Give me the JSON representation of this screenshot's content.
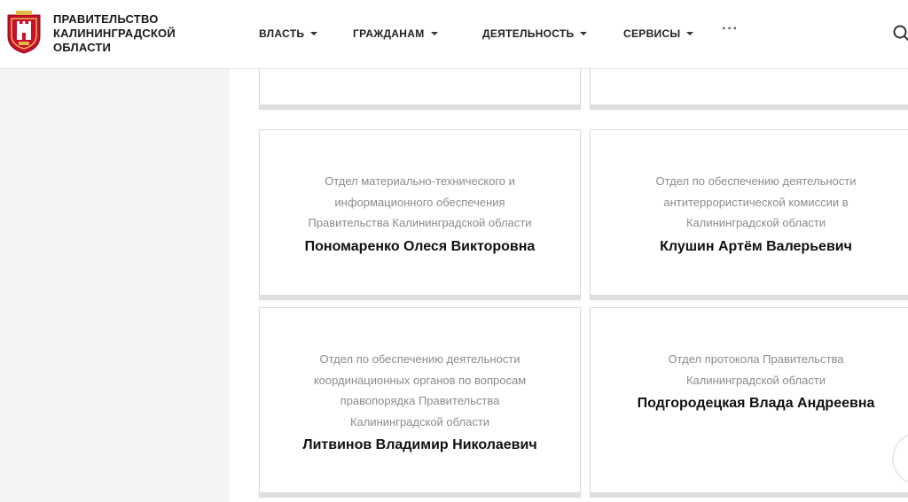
{
  "header": {
    "org_name": [
      "ПРАВИТЕЛЬСТВО",
      "КАЛИНИНГРАДСКОЙ",
      "ОБЛАСТИ"
    ],
    "logo_icon": "coat-of-arms-icon",
    "nav": [
      {
        "label": "ВЛАСТЬ"
      },
      {
        "label": "ГРАЖДАНАМ"
      },
      {
        "label": "ДЕЯТЕЛЬНОСТЬ"
      },
      {
        "label": "СЕРВИСЫ"
      }
    ],
    "more_label": "···",
    "search_icon": "search-icon"
  },
  "colors": {
    "accent": "#c8102e",
    "gold": "#e0b84a",
    "muted_text": "#8c8c8c",
    "panel_bg": "#f4f4f4"
  },
  "cards": [
    {
      "department": [],
      "person": ""
    },
    {
      "department": [],
      "person": ""
    },
    {
      "department": [
        "Отдел материально-технического и",
        "информационного обеспечения",
        "Правительства Калининградской области"
      ],
      "person": "Пономаренко Олеся Викторовна"
    },
    {
      "department": [
        "Отдел по обеспечению деятельности",
        "антитеррористической комиссии в",
        "Калининградской области"
      ],
      "person": "Клушин Артём Валерьевич"
    },
    {
      "department": [
        "Отдел по обеспечению деятельности",
        "координационных органов по вопросам",
        "правопорядка Правительства",
        "Калининградской области"
      ],
      "person": "Литвинов Владимир Николаевич"
    },
    {
      "department": [
        "Отдел протокола Правительства",
        "Калининградской области"
      ],
      "person": "Подгородецкая Влада Андреевна"
    }
  ]
}
